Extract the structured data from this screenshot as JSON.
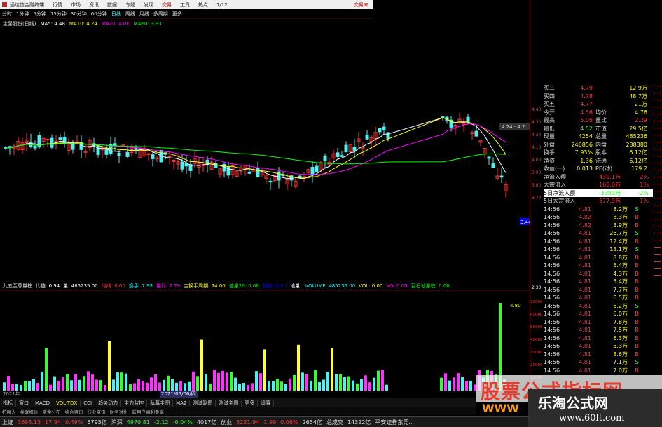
{
  "titlebar": {
    "app": "通达信金融终端",
    "menus": [
      "行情",
      "市场",
      "资讯",
      "数据",
      "专题",
      "发现",
      "交易",
      "工具",
      "热点",
      "1/12"
    ],
    "right": "交易未"
  },
  "toolbar": {
    "items": [
      "分时",
      "1分钟",
      "5分钟",
      "15分钟",
      "30分钟",
      "60分钟",
      "日线",
      "周线",
      "月线",
      "多周期",
      "更多"
    ],
    "active": "日线"
  },
  "ma": {
    "name": "宝馨股份(日线)",
    "ma5": "MA5: 4.48",
    "ma10": "MA10: 4.24",
    "ma20": "MA20: 4.01",
    "ma60": "MA60: 3.93"
  },
  "price_axis": [
    "4.40",
    "4.30",
    "4.20",
    "4.10",
    "4.00",
    "3.90",
    "3.80",
    "3.70"
  ],
  "cross_label": "3.44",
  "price_tag": "4.24 · 4.2",
  "volume_axis": [
    "70000",
    "60000",
    "50000",
    "40000",
    "30000",
    "20000",
    "10000"
  ],
  "volume_peak": "4.80",
  "volume_axis_top": "2.33",
  "vol_indicator": {
    "name": "九五至尊量柱",
    "ratio": "比值: 0.94",
    "vol": "量: 485235.00",
    "items": [
      "均线: 0.00",
      "换手: 7.93",
      "量比: 2.29",
      "主换手周期: 74.00",
      "倍量20: 0.00",
      "倍量: 0.00",
      "地量: ",
      "VOLUME: 485235.00",
      "VOL: 0.00",
      "VO: 0.00",
      "百日地量柱: 0.00"
    ]
  },
  "quotes": [
    {
      "k": "买三",
      "v": "4.79",
      "k2": "",
      "v2": "12.9万"
    },
    {
      "k": "买四",
      "v": "4.78",
      "k2": "",
      "v2": "48.7万"
    },
    {
      "k": "买五",
      "v": "4.77",
      "k2": "",
      "v2": "21万"
    },
    {
      "k": "今开",
      "v": "4.56",
      "k2": "均价",
      "v2": "4.76"
    },
    {
      "k": "最高",
      "v": "5.05",
      "k2": "量比",
      "v2": "2.29"
    },
    {
      "k": "最低",
      "v": "4.52",
      "k2": "市值",
      "v2": "29.5亿"
    },
    {
      "k": "现量",
      "v": "4254",
      "k2": "总量",
      "v2": "485236"
    },
    {
      "k": "外盘",
      "v": "246856",
      "k2": "内盘",
      "v2": "238380"
    },
    {
      "k": "换手",
      "v": "7.93%",
      "k2": "股本",
      "v2": "6.12亿"
    },
    {
      "k": "净资",
      "v": "1.36",
      "k2": "流通",
      "v2": "6.12亿"
    },
    {
      "k": "收益(一)",
      "v": "0.013",
      "k2": "PE(动)",
      "v2": "179.2"
    }
  ],
  "flows": [
    {
      "k": "净流入额",
      "v": "439.1万",
      "p": "2%"
    },
    {
      "k": "大宗流入",
      "v": "165.0万",
      "p": "1%"
    },
    {
      "k": "5日净流入额",
      "v": "-1380万",
      "p": "-2%"
    },
    {
      "k": "5日大宗流入",
      "v": "577.9万",
      "p": "1%"
    }
  ],
  "ticks": [
    {
      "t": "14:56",
      "pr": "4.81",
      "vol": "8.2万",
      "bs": "S"
    },
    {
      "t": "14:56",
      "pr": "4.82",
      "vol": "8.3万",
      "bs": "B"
    },
    {
      "t": "14:56",
      "pr": "4.82",
      "vol": "3.9万",
      "bs": "B"
    },
    {
      "t": "14:56",
      "pr": "4.81",
      "vol": "26.7万",
      "bs": "S"
    },
    {
      "t": "14:56",
      "pr": "4.81",
      "vol": "12.4万",
      "bs": "B"
    },
    {
      "t": "14:56",
      "pr": "4.81",
      "vol": "13.1万",
      "bs": "S"
    },
    {
      "t": "14:56",
      "pr": "4.81",
      "vol": "8.8万",
      "bs": "B"
    },
    {
      "t": "14:56",
      "pr": "4.81",
      "vol": "5.4万",
      "bs": "B"
    },
    {
      "t": "14:56",
      "pr": "4.81",
      "vol": "4.3万",
      "bs": "B"
    },
    {
      "t": "14:56",
      "pr": "4.81",
      "vol": "5.4万",
      "bs": "B"
    },
    {
      "t": "14:56",
      "pr": "4.81",
      "vol": "7.7万",
      "bs": "B"
    },
    {
      "t": "14:56",
      "pr": "4.81",
      "vol": "6.5万",
      "bs": "B"
    },
    {
      "t": "14:56",
      "pr": "4.81",
      "vol": "6.2万",
      "bs": "S"
    },
    {
      "t": "14:56",
      "pr": "4.81",
      "vol": "6.0万",
      "bs": "B"
    },
    {
      "t": "14:56",
      "pr": "4.81",
      "vol": "7.8万",
      "bs": "B"
    },
    {
      "t": "14:56",
      "pr": "4.81",
      "vol": "7.5万",
      "bs": "B"
    },
    {
      "t": "14:56",
      "pr": "4.81",
      "vol": "6.3万",
      "bs": "B"
    },
    {
      "t": "14:56",
      "pr": "4.81",
      "vol": "5.3万",
      "bs": "B"
    },
    {
      "t": "14:56",
      "pr": "4.81",
      "vol": "8.6万",
      "bs": "B"
    },
    {
      "t": "14:56",
      "pr": "4.81",
      "vol": "7.1万",
      "bs": "S"
    },
    {
      "t": "14:56",
      "pr": "4.81",
      "vol": "7.0万",
      "bs": "B"
    }
  ],
  "date_strip": {
    "year": "2021年",
    "date": "2021/05/06/四"
  },
  "tabs": {
    "items": [
      "指标",
      "窗口",
      "MACD",
      "VOL-TDX",
      "CCI",
      "趋势动力",
      "主力监控",
      "私募主图",
      "MA2",
      "测试副图",
      "测试主图",
      "更多",
      "设置"
    ],
    "active": "VOL-TDX"
  },
  "subtabs": [
    "扩展人",
    "关联报价",
    "资金分布",
    "综合资讯",
    "行业资讯",
    "财务对比",
    "新用户福利专享"
  ],
  "statusbar": {
    "sh_label": "上证",
    "sh_val": "3693.13",
    "sh_chg": "17.94",
    "sh_pct": "0.49%",
    "sh_amt": "6795亿",
    "sz_label": "沪深",
    "sz_val": "4970.81",
    "sz_chg": "-2.12",
    "sz_pct": "-0.04%",
    "sz_amt": "4017亿",
    "cy_label": "创业",
    "cy_val": "3221.94",
    "cy_chg": "1.99",
    "cy_pct": "0.06%",
    "cy_amt": "2654亿",
    "total": "总成交",
    "total_amt": "14322亿",
    "broker": "平安证券东莞..."
  },
  "watermark": {
    "red": "股票公式指标网",
    "www": "WWW",
    "title": "乐淘公式网",
    "url": "www.60lt.com"
  },
  "colors": {
    "up": "#ff3333",
    "down": "#4ff0f0",
    "ma5": "#ffffff",
    "ma10": "#ffff00",
    "ma20": "#ff00ff",
    "ma60": "#00ff00",
    "accent": "#ff0000"
  }
}
